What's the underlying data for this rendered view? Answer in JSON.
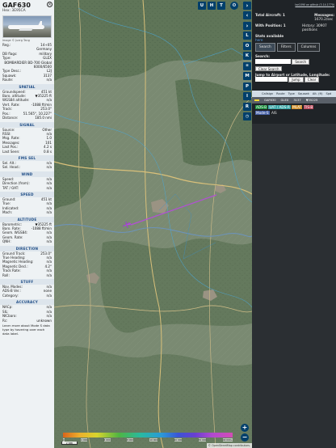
{
  "aircraft": {
    "callsign": "GAF630",
    "hex_line": "Hex: 3E95CA",
    "photo_credit": "Image © Juerg Tang",
    "info_rows": [
      {
        "k": "Reg.:",
        "v": "14+05"
      },
      {
        "k": "",
        "v": "Germany"
      },
      {
        "k": "DB flags:",
        "v": "military"
      },
      {
        "k": "Type:",
        "v": "GLEX"
      },
      {
        "k": "",
        "v": "BOMBARDIER BD-700 Global 6000/6500"
      },
      {
        "k": "Type Desc.:",
        "v": "L2J"
      },
      {
        "k": "Squawk:",
        "v": "3137"
      },
      {
        "k": "Route:",
        "v": "n/a"
      }
    ]
  },
  "sections": {
    "spatial": {
      "title": "SPATIAL",
      "rows": [
        {
          "k": "Groundspeed:",
          "v": "451 kt"
        },
        {
          "k": "Baro. altitude:",
          "v": "▼35225 ft"
        },
        {
          "k": "WGS84 altitude:",
          "v": "n/a"
        },
        {
          "k": "Vert. Rate:",
          "v": "-1088 ft/min"
        },
        {
          "k": "Track:",
          "v": "253.0°"
        },
        {
          "k": "Pos.:",
          "v": "51.565°, 10.227°"
        },
        {
          "k": "Distance:",
          "v": "185.0 nmi"
        }
      ]
    },
    "signal": {
      "title": "SIGNAL",
      "rows": [
        {
          "k": "Source:",
          "v": "Other"
        },
        {
          "k": "RSSI:",
          "v": "n/a"
        },
        {
          "k": "Msg. Rate:",
          "v": "1.0"
        },
        {
          "k": "Messages:",
          "v": "101"
        },
        {
          "k": "Last Pos.:",
          "v": "4.2 s"
        },
        {
          "k": "Last Seen:",
          "v": "0.8 s"
        }
      ]
    },
    "fms": {
      "title": "FMS SEL",
      "rows": [
        {
          "k": "Sel. Alt.:",
          "v": "n/a"
        },
        {
          "k": "Sel. Head.:",
          "v": "n/a"
        }
      ]
    },
    "wind": {
      "title": "WIND",
      "rows": [
        {
          "k": "Speed:",
          "v": "n/a"
        },
        {
          "k": "Direction (from):",
          "v": "n/a"
        },
        {
          "k": "TAT / OAT:",
          "v": "n/a"
        }
      ]
    },
    "speed": {
      "title": "SPEED",
      "rows": [
        {
          "k": "Ground:",
          "v": "451 kt"
        },
        {
          "k": "True:",
          "v": "n/a"
        },
        {
          "k": "Indicated:",
          "v": "n/a"
        },
        {
          "k": "Mach:",
          "v": "n/a"
        }
      ]
    },
    "altitude": {
      "title": "ALTITUDE",
      "rows": [
        {
          "k": "Barometric:",
          "v": "▼35225 ft"
        },
        {
          "k": "Baro. Rate:",
          "v": "-1088 ft/min"
        },
        {
          "k": "Geom. WGS84:",
          "v": "n/a"
        },
        {
          "k": "Geom. Rate:",
          "v": "n/a"
        },
        {
          "k": "QNH:",
          "v": "n/a"
        }
      ]
    },
    "direction": {
      "title": "DIRECTION",
      "rows": [
        {
          "k": "Ground Track:",
          "v": "253.0°"
        },
        {
          "k": "True Heading:",
          "v": "n/a"
        },
        {
          "k": "Magnetic Heading:",
          "v": "n/a"
        },
        {
          "k": "Magnetic Decl.:",
          "v": "4.2°"
        },
        {
          "k": "Track Rate:",
          "v": "n/a"
        },
        {
          "k": "Roll:",
          "v": "n/a"
        }
      ]
    },
    "stuff": {
      "title": "STUFF",
      "rows": [
        {
          "k": "Nav. Modes:",
          "v": "n/a"
        },
        {
          "k": "ADS-B Ver.:",
          "v": "none"
        },
        {
          "k": "Category:",
          "v": "n/a"
        }
      ]
    },
    "accuracy": {
      "title": "ACCURACY",
      "rows": [
        {
          "k": "NACp:",
          "v": "n/a"
        },
        {
          "k": "SIL:",
          "v": "n/a"
        },
        {
          "k": "NICbaro:",
          "v": "n/a"
        },
        {
          "k": "Rc:",
          "v": "unknown"
        }
      ]
    },
    "note": "Learn more about Mode S data type by hovering over each data label."
  },
  "map": {
    "top_buttons": [
      "U",
      "H",
      "T"
    ],
    "side_buttons": [
      "L",
      "O",
      "K",
      "M",
      "P",
      "I",
      "R"
    ],
    "colorbar_labels": [
      "0",
      "4 000",
      "6 000",
      "8 000",
      "10 000",
      "20 000",
      "30 000",
      "40 000+"
    ],
    "scale_label": "2 NMI",
    "attribution": "© OpenStreetMap contributors.",
    "track_color": "#b34fd6"
  },
  "right_panel": {
    "github": "tar1090 on github (3.14.1770)",
    "total_aircraft_label": "Total Aircraft: 1",
    "messages_label": "Messages:",
    "messages_value": "1670.2/sec",
    "with_position_label": "With Position: 1",
    "history_label": "History: 30907 positions",
    "stats_label": "Stats available",
    "stats_link": "here",
    "tabs": [
      "Search",
      "Filters",
      "Columns"
    ],
    "search_label": "Search:",
    "search_button": "Search",
    "clear_search": "Clear Search",
    "jump_label": "Jump to Airport or Latitude, Longitude:",
    "jump_button": "Jump",
    "clear_button": "Clear",
    "table_headers": [
      "Callsign",
      "Route",
      "Type",
      "Squawk",
      "Alt. (ft)",
      "Spd"
    ],
    "table_row": {
      "callsign": "GAF630",
      "type": "GLEX",
      "squawk": "3137",
      "alt": "▼35225"
    },
    "filter_chips": [
      "ADS-B",
      "UAT / ADS-R",
      "MLAT",
      "TIS-B",
      "Mode-S",
      "AIS"
    ]
  }
}
